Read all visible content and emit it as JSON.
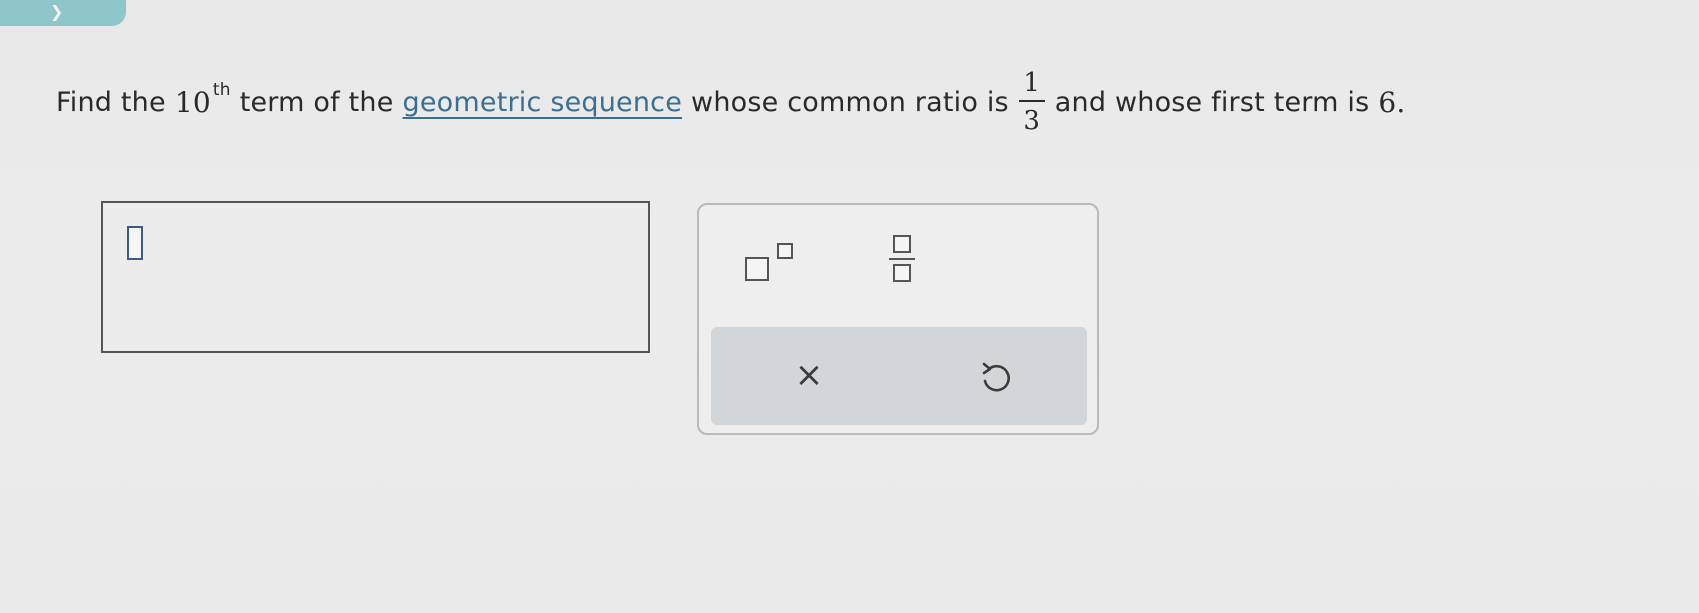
{
  "question": {
    "prefix": "Find the",
    "ordinal_number": "10",
    "ordinal_suffix": "th",
    "after_ordinal": "term of the",
    "link_text": "geometric sequence",
    "after_link": "whose common ratio is",
    "ratio_numerator": "1",
    "ratio_denominator": "3",
    "after_ratio": "and whose first term is",
    "first_term": "6",
    "end": "."
  },
  "answer": {
    "value": ""
  },
  "palette": {
    "tools": [
      "exponent-template",
      "fraction-template"
    ],
    "actions": {
      "clear_symbol": "×",
      "undo_icon": "undo-icon"
    }
  },
  "colors": {
    "link": "#3a6f93",
    "cursor_box": "#3b5b86",
    "action_bar": "#d3d6d8",
    "corner_badge": "#8fc6c9"
  }
}
